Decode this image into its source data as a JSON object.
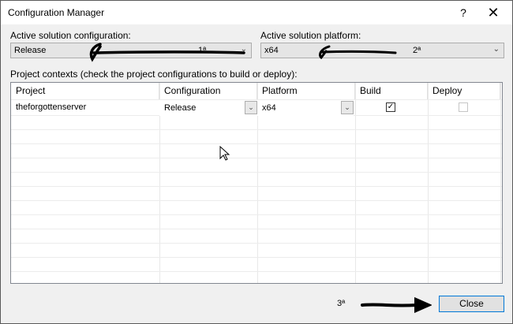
{
  "window": {
    "title": "Configuration Manager",
    "help_glyph": "?",
    "close_glyph": "✕"
  },
  "config": {
    "label": "Active solution configuration:",
    "value": "Release",
    "annotation": "1ª"
  },
  "platform": {
    "label": "Active solution platform:",
    "value": "x64",
    "annotation": "2ª"
  },
  "contexts": {
    "label": "Project contexts (check the project configurations to build or deploy):",
    "columns": [
      "Project",
      "Configuration",
      "Platform",
      "Build",
      "Deploy"
    ],
    "rows": [
      {
        "project": "theforgottenserver",
        "configuration": "Release",
        "platform": "x64",
        "build": true,
        "deploy": false
      }
    ]
  },
  "footer": {
    "annotation": "3ª",
    "close_label": "Close"
  },
  "icons": {
    "dropdown": "chevron-down-icon",
    "check": "checkmark-icon"
  }
}
